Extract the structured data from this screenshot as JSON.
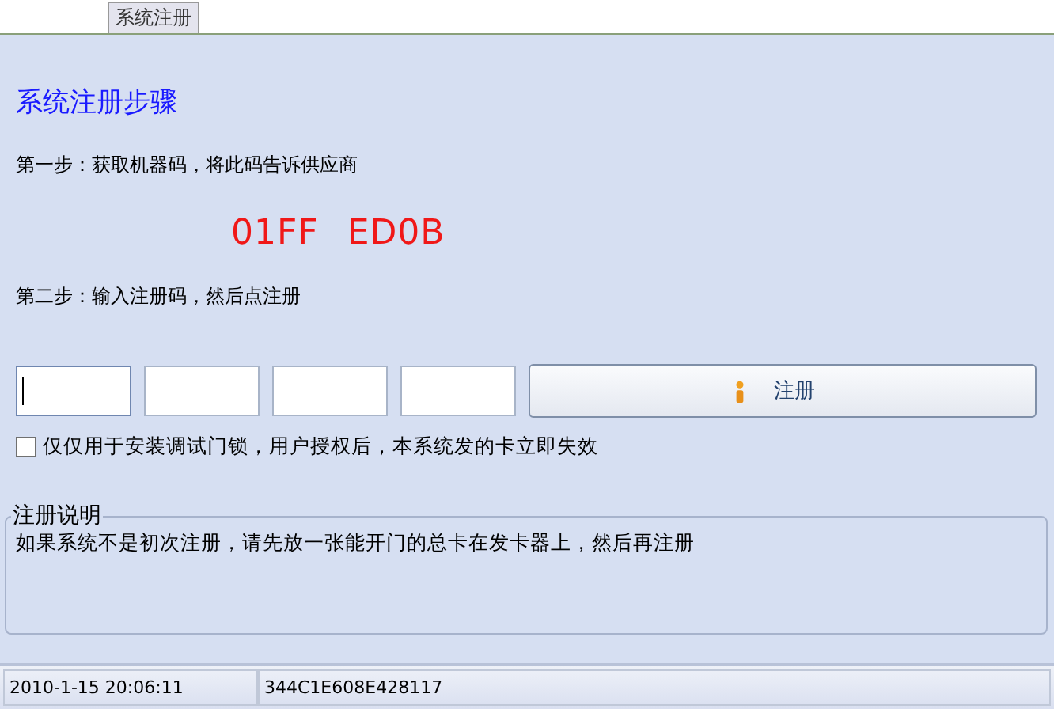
{
  "tabs": [
    {
      "label": "系统注册",
      "selected": true
    }
  ],
  "heading": "系统注册步骤",
  "step1": "第一步：获取机器码，将此码告诉供应商",
  "machine_code": [
    "01FF",
    "ED0B"
  ],
  "step2": "第二步：输入注册码，然后点注册",
  "code_fields": [
    {
      "focused": true
    },
    {
      "focused": false
    },
    {
      "focused": false
    },
    {
      "focused": false
    }
  ],
  "register_button": {
    "label": "注册"
  },
  "checkbox": {
    "label": "仅仅用于安装调试门锁，用户授权后，本系统发的卡立即失效",
    "checked": false
  },
  "notes": {
    "title": "注册说明",
    "text": "如果系统不是初次注册，请先放一张能开门的总卡在发卡器上，然后再注册"
  },
  "status_bar": [
    "2010-1-15 20:06:11",
    "344C1E608E428117"
  ]
}
